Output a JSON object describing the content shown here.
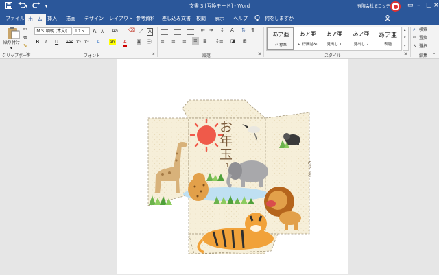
{
  "title_bar": {
    "document_title": "文書 3 [互換モード] - Word",
    "account_name": "有限会社 Eコッチ",
    "save_icon": "save-icon",
    "undo_icon": "undo-icon",
    "redo_icon": "redo-icon",
    "quick_access_icon": "chevron-down-icon",
    "window_controls": [
      "minimize-icon",
      "restore-icon",
      "close-icon"
    ]
  },
  "tabs": [
    "ファイル",
    "ホーム",
    "挿入",
    "描画",
    "デザイン",
    "レイアウト",
    "参考資料",
    "差し込み文書",
    "校閲",
    "表示",
    "ヘルプ"
  ],
  "tell_me": "何をしますか",
  "ribbon": {
    "clipboard": {
      "paste_label": "貼り付け",
      "group_label": "クリップボード"
    },
    "font": {
      "font_name": "ＭＳ 明朝 (本文(",
      "font_size": "10.5",
      "grow": "A",
      "shrink": "A",
      "case": "Aa",
      "bold": "B",
      "italic": "I",
      "underline": "U",
      "strike": "abc",
      "subscript": "x₂",
      "superscript": "x²",
      "highlight": "ab",
      "font_color": "A",
      "shade": "A",
      "phonetic": "ア",
      "char_border": "A",
      "group_label": "フォント"
    },
    "paragraph": {
      "group_label": "段落"
    },
    "styles": {
      "items": [
        {
          "sample": "あア亜",
          "name": "↵ 標準"
        },
        {
          "sample": "あア亜",
          "name": "↵ 行間詰め"
        },
        {
          "sample": "あア亜",
          "name": "見出し 1"
        },
        {
          "sample": "あア亜",
          "name": "見出し 2"
        },
        {
          "sample": "あア亜",
          "name": "表題"
        }
      ],
      "group_label": "スタイル"
    },
    "editing": {
      "find": "検索",
      "replace": "置換",
      "select": "選択",
      "group_label": "編集"
    }
  },
  "envelope": {
    "title": "お年玉",
    "fold_label": "のりしろ"
  },
  "colors": {
    "accent": "#2b579a",
    "paper": "#f6efd9",
    "sun": "#ef5a4a"
  }
}
